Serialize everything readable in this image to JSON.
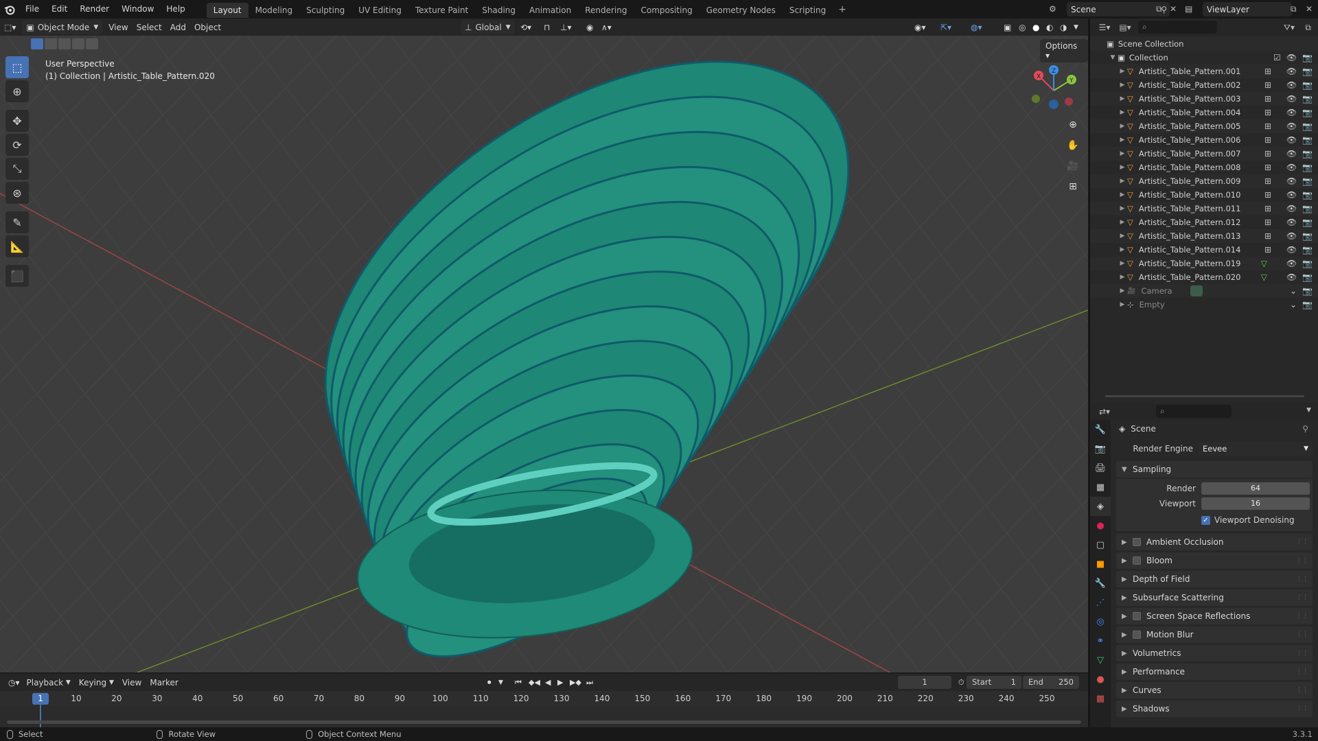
{
  "topbar": {
    "menus": [
      "File",
      "Edit",
      "Render",
      "Window",
      "Help"
    ],
    "workspaces": [
      "Layout",
      "Modeling",
      "Sculpting",
      "UV Editing",
      "Texture Paint",
      "Shading",
      "Animation",
      "Rendering",
      "Compositing",
      "Geometry Nodes",
      "Scripting"
    ],
    "active_workspace": "Layout",
    "scene": "Scene",
    "view_layer": "ViewLayer"
  },
  "viewport_header": {
    "mode": "Object Mode",
    "menus": [
      "View",
      "Select",
      "Add",
      "Object"
    ],
    "transform_orientation": "Global",
    "options": "Options"
  },
  "viewport": {
    "perspective": "User Perspective",
    "context": "(1) Collection | Artistic_Table_Pattern.020",
    "colors": {
      "background": "#3d3d3d",
      "grid": "#464646",
      "x_axis": "#b04848",
      "y_axis": "#6a8a2a",
      "object": "#1f8c7a"
    },
    "gizmo_axes": [
      "X",
      "Y",
      "Z"
    ]
  },
  "outliner": {
    "root": "Scene Collection",
    "collection": "Collection",
    "items": [
      {
        "name": "Artistic_Table_Pattern.001",
        "type": "mesh",
        "modifier": "grid"
      },
      {
        "name": "Artistic_Table_Pattern.002",
        "type": "mesh",
        "modifier": "grid"
      },
      {
        "name": "Artistic_Table_Pattern.003",
        "type": "mesh",
        "modifier": "grid"
      },
      {
        "name": "Artistic_Table_Pattern.004",
        "type": "mesh",
        "modifier": "grid"
      },
      {
        "name": "Artistic_Table_Pattern.005",
        "type": "mesh",
        "modifier": "grid"
      },
      {
        "name": "Artistic_Table_Pattern.006",
        "type": "mesh",
        "modifier": "grid"
      },
      {
        "name": "Artistic_Table_Pattern.007",
        "type": "mesh",
        "modifier": "grid"
      },
      {
        "name": "Artistic_Table_Pattern.008",
        "type": "mesh",
        "modifier": "grid"
      },
      {
        "name": "Artistic_Table_Pattern.009",
        "type": "mesh",
        "modifier": "grid"
      },
      {
        "name": "Artistic_Table_Pattern.010",
        "type": "mesh",
        "modifier": "grid"
      },
      {
        "name": "Artistic_Table_Pattern.011",
        "type": "mesh",
        "modifier": "grid"
      },
      {
        "name": "Artistic_Table_Pattern.012",
        "type": "mesh",
        "modifier": "grid"
      },
      {
        "name": "Artistic_Table_Pattern.013",
        "type": "mesh",
        "modifier": "grid"
      },
      {
        "name": "Artistic_Table_Pattern.014",
        "type": "mesh",
        "modifier": "grid"
      },
      {
        "name": "Artistic_Table_Pattern.019",
        "type": "mesh",
        "modifier": "mesh"
      },
      {
        "name": "Artistic_Table_Pattern.020",
        "type": "mesh",
        "modifier": "mesh"
      },
      {
        "name": "Camera",
        "type": "camera",
        "modifier": ""
      },
      {
        "name": "Empty",
        "type": "empty",
        "modifier": ""
      }
    ]
  },
  "properties": {
    "context": "Scene",
    "render_engine_label": "Render Engine",
    "render_engine": "Eevee",
    "sampling": "Sampling",
    "render_label": "Render",
    "render_samples": "64",
    "viewport_label": "Viewport",
    "viewport_samples": "16",
    "viewport_denoising": "Viewport Denoising",
    "panels": [
      {
        "label": "Ambient Occlusion",
        "checkbox": true
      },
      {
        "label": "Bloom",
        "checkbox": true
      },
      {
        "label": "Depth of Field",
        "checkbox": false
      },
      {
        "label": "Subsurface Scattering",
        "checkbox": false
      },
      {
        "label": "Screen Space Reflections",
        "checkbox": true
      },
      {
        "label": "Motion Blur",
        "checkbox": true
      },
      {
        "label": "Volumetrics",
        "checkbox": false
      },
      {
        "label": "Performance",
        "checkbox": false
      },
      {
        "label": "Curves",
        "checkbox": false
      },
      {
        "label": "Shadows",
        "checkbox": false
      }
    ]
  },
  "timeline": {
    "menus": [
      "Playback",
      "Keying",
      "View",
      "Marker"
    ],
    "current_frame": "1",
    "start_label": "Start",
    "start": "1",
    "end_label": "End",
    "end": "250",
    "ticks": [
      "10",
      "20",
      "30",
      "40",
      "50",
      "60",
      "70",
      "80",
      "90",
      "100",
      "110",
      "120",
      "130",
      "140",
      "150",
      "160",
      "170",
      "180",
      "190",
      "200",
      "210",
      "220",
      "230",
      "240",
      "250"
    ]
  },
  "statusbar": {
    "select": "Select",
    "rotate": "Rotate View",
    "context_menu": "Object Context Menu",
    "version": "3.3.1"
  }
}
